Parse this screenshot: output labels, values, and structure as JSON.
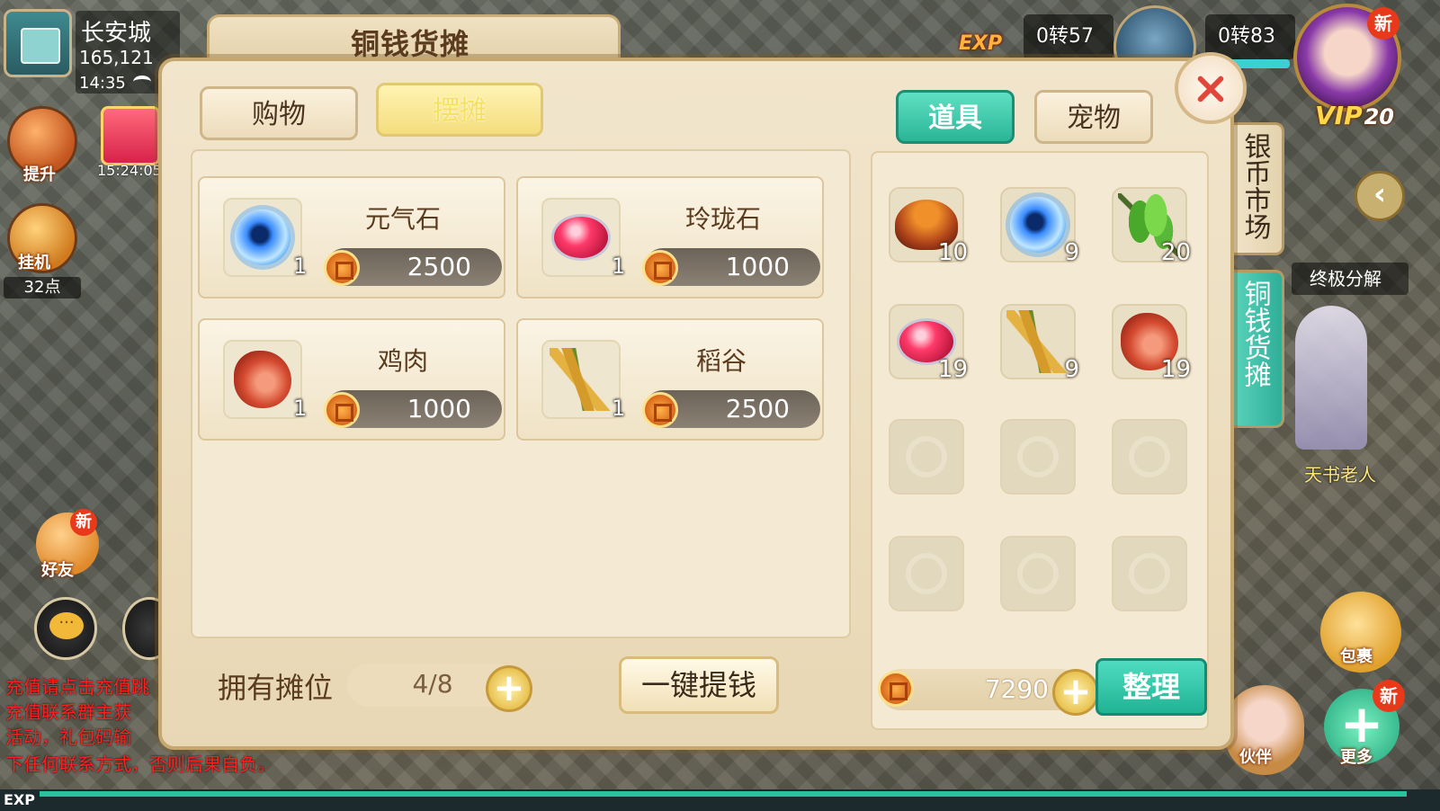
{
  "hud": {
    "city": "长安城",
    "coords": "165,121",
    "time": "14:35",
    "upgrade_label": "提升",
    "gift_timer": "15:24:05",
    "auto_label": "挂机",
    "points": "32点",
    "friends_label": "好友",
    "friends_new": "新",
    "notice_lines": [
      "充值请点击充值跳",
      "充值联系群主获",
      "活动，礼包码输",
      "下任何联系方式，否则后果自负。"
    ],
    "exp_label": "EXP",
    "exp_icon": "EXP",
    "level1": "0转57",
    "level2": "0转83",
    "new_badge": "新",
    "vip": "VIP",
    "vip_level": "20",
    "silver_market": "银币市场",
    "copper_stall": "铜钱货摊",
    "decompose": "终极分解",
    "npc_name": "天书老人",
    "bag_label": "包裹",
    "partner_label": "伙伴",
    "more_label": "更多",
    "more_new": "新"
  },
  "panel": {
    "title": "铜钱货摊",
    "tabs": [
      {
        "label": "购物",
        "active": false
      },
      {
        "label": "摆摊",
        "active": true
      }
    ],
    "stall_items": [
      {
        "name": "元气石",
        "count": "1",
        "price": "2500",
        "icon": "orb-icon"
      },
      {
        "name": "玲珑石",
        "count": "1",
        "price": "1000",
        "icon": "gem-icon"
      },
      {
        "name": "鸡肉",
        "count": "1",
        "price": "1000",
        "icon": "meat-icon"
      },
      {
        "name": "稻谷",
        "count": "1",
        "price": "2500",
        "icon": "grain-icon"
      }
    ],
    "stall_count_label": "拥有摊位",
    "stall_count": "4/8",
    "withdraw_label": "一键提钱",
    "bag_tabs": [
      {
        "label": "道具",
        "active": true
      },
      {
        "label": "宠物",
        "active": false
      }
    ],
    "bag_items": [
      {
        "icon": "mushroom-icon",
        "count": "10"
      },
      {
        "icon": "orb-icon",
        "count": "9"
      },
      {
        "icon": "leaf-icon",
        "count": "20"
      },
      {
        "icon": "gem-icon",
        "count": "19"
      },
      {
        "icon": "grain-icon",
        "count": "9"
      },
      {
        "icon": "meat-icon",
        "count": "19"
      }
    ],
    "money": "7290",
    "sort_label": "整理"
  },
  "colors": {
    "accent_green": "#2ab596",
    "panel_bg": "#f1e5cc",
    "text_brown": "#5a3b1e",
    "close_red": "#e0463a"
  }
}
